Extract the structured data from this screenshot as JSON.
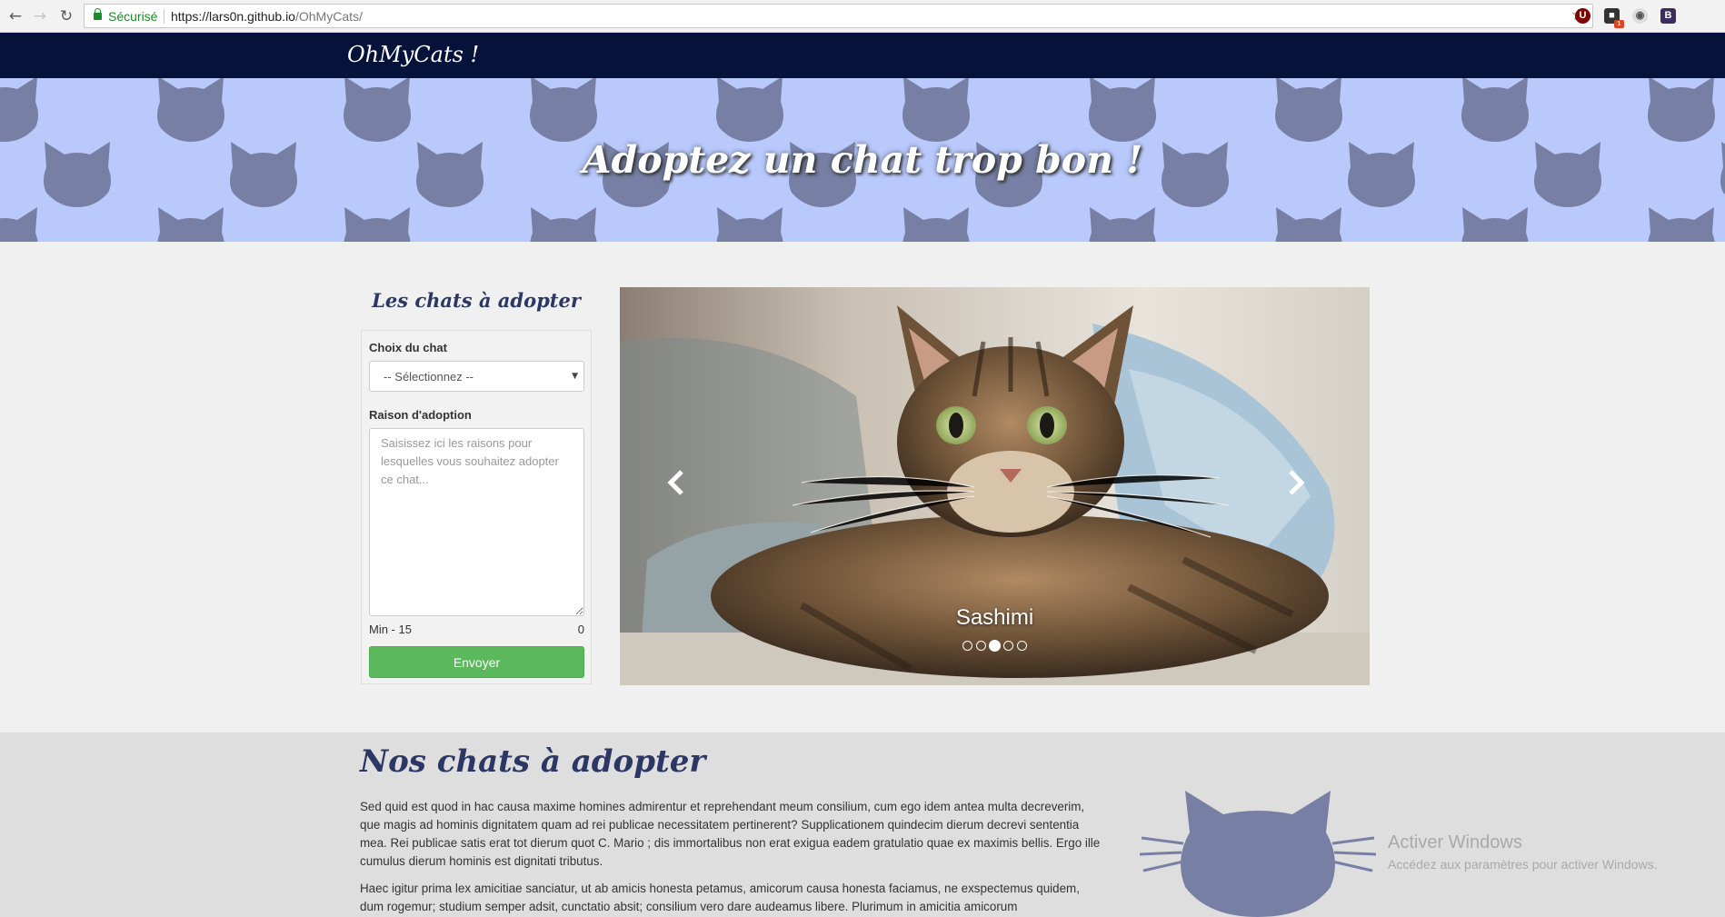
{
  "browser": {
    "secure_label": "Sécurisé",
    "url_host": "https://lars0n.github.io",
    "url_path": "/OhMyCats/",
    "extension_badge": "1"
  },
  "navbar": {
    "brand": "OhMyCats !"
  },
  "hero": {
    "title": "Adoptez un chat trop bon !"
  },
  "sidebar": {
    "title": "Les chats à adopter",
    "cat_label": "Choix du chat",
    "cat_select_value": "-- Sélectionnez --",
    "reason_label": "Raison d'adoption",
    "reason_placeholder": "Saisissez ici les raisons pour lesquelles vous souhaitez adopter ce chat...",
    "counter_min": "Min - 15",
    "counter_value": "0",
    "submit_label": "Envoyer"
  },
  "carousel": {
    "caption": "Sashimi",
    "slide_count": 5,
    "active_index": 2
  },
  "about": {
    "title": "Nos chats à adopter",
    "paragraph1": "Sed quid est quod in hac causa maxime homines admirentur et reprehendant meum consilium, cum ego idem antea multa decreverim, que magis ad hominis dignitatem quam ad rei publicae necessitatem pertinerent? Supplicationem quindecim dierum decrevi sententia mea. Rei publicae satis erat tot dierum quot C. Mario ; dis immortalibus non erat exigua eadem gratulatio quae ex maximis bellis. Ergo ille cumulus dierum hominis est dignitati tributus.",
    "paragraph2": "Haec igitur prima lex amicitiae sanciatur, ut ab amicis honesta petamus, amicorum causa honesta faciamus, ne exspectemus quidem, dum rogemur; studium semper adsit, cunctatio absit; consilium vero dare audeamus libere. Plurimum in amicitia amicorum"
  },
  "windows_watermark": {
    "title": "Activer Windows",
    "subtitle": "Accédez aux paramètres pour activer Windows."
  },
  "colors": {
    "navbar": "#05133a",
    "hero_bg": "#b9c9fb",
    "cat_silhouette": "#7780a4",
    "heading": "#2c3765",
    "submit": "#5cb85c"
  }
}
